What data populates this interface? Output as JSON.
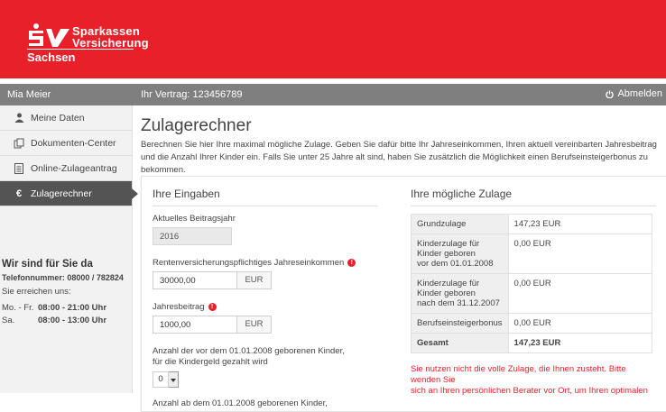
{
  "brand": {
    "line1": "Sparkassen",
    "line2": "Versicherung",
    "line3": "Sachsen"
  },
  "topbar": {
    "user_name": "Mia Meier",
    "contract": "Ihr Vertrag: 123456789",
    "logout_label": "Abmelden"
  },
  "sidebar": {
    "items": [
      {
        "label": "Meine Daten",
        "icon": "user-icon"
      },
      {
        "label": "Dokumenten-Center",
        "icon": "documents-icon"
      },
      {
        "label": "Online-Zulageantrag",
        "icon": "form-icon"
      },
      {
        "label": "Zulagerechner",
        "icon": "euro-icon"
      }
    ],
    "active_index": 3
  },
  "contact": {
    "title": "Wir sind für Sie da",
    "phone": "Telefonnummer: 08000 / 782824",
    "reach": "Sie erreichen uns:",
    "hours": [
      {
        "days": "Mo. - Fr.",
        "time": "08:00 - 21:00 Uhr"
      },
      {
        "days": "Sa.",
        "time": "08:00 - 13:00 Uhr"
      }
    ]
  },
  "main": {
    "title": "Zulagerechner",
    "intro": "Berechnen Sie hier Ihre maximal mögliche Zulage. Geben Sie dafür bitte Ihr Jahreseinkommen, Ihren aktuell vereinbarten Jahresbeitrag und die Anzahl Ihrer Kinder ein. Falls Sie unter 25 Jahre alt sind, haben Sie zusätzlich die Möglichkeit einen Berufseinsteigerbonus zu bekommen."
  },
  "inputs": {
    "title": "Ihre Eingaben",
    "year_label": "Aktuelles Beitragsjahr",
    "year_value": "2016",
    "income_label": "Rentenversicherungspflichtiges Jahreseinkommen",
    "income_value": "30000,00",
    "income_unit": "EUR",
    "contribution_label": "Jahresbeitrag",
    "contribution_value": "1000,00",
    "contribution_unit": "EUR",
    "children_before_label_1": "Anzahl der vor dem 01.01.2008 geborenen Kinder,",
    "children_before_label_2": "für die Kindergeld gezahlt wird",
    "children_before_value": "0",
    "children_after_label": "Anzahl ab dem 01.01.2008 geborenen Kinder,",
    "info_glyph": "!"
  },
  "results": {
    "title": "Ihre mögliche Zulage",
    "rows": [
      {
        "label": [
          "Grundzulage"
        ],
        "value": "147,23 EUR"
      },
      {
        "label": [
          "Kinderzulage für",
          "Kinder geboren",
          "vor dem 01.01.2008"
        ],
        "value": "0,00 EUR"
      },
      {
        "label": [
          "Kinderzulage für",
          "Kinder geboren",
          "nach dem 31.12.2007"
        ],
        "value": "0,00 EUR"
      },
      {
        "label": [
          "Berufseinsteigerbonus"
        ],
        "value": "0,00 EUR"
      }
    ],
    "total_label": "Gesamt",
    "total_value": "147,23 EUR",
    "notice_1": "Sie nutzen nicht die volle Zulage, die Ihnen zusteht. Bitte wenden Sie",
    "notice_2": "sich an Ihren persönlichen Berater vor Ort, um Ihren optimalen"
  }
}
